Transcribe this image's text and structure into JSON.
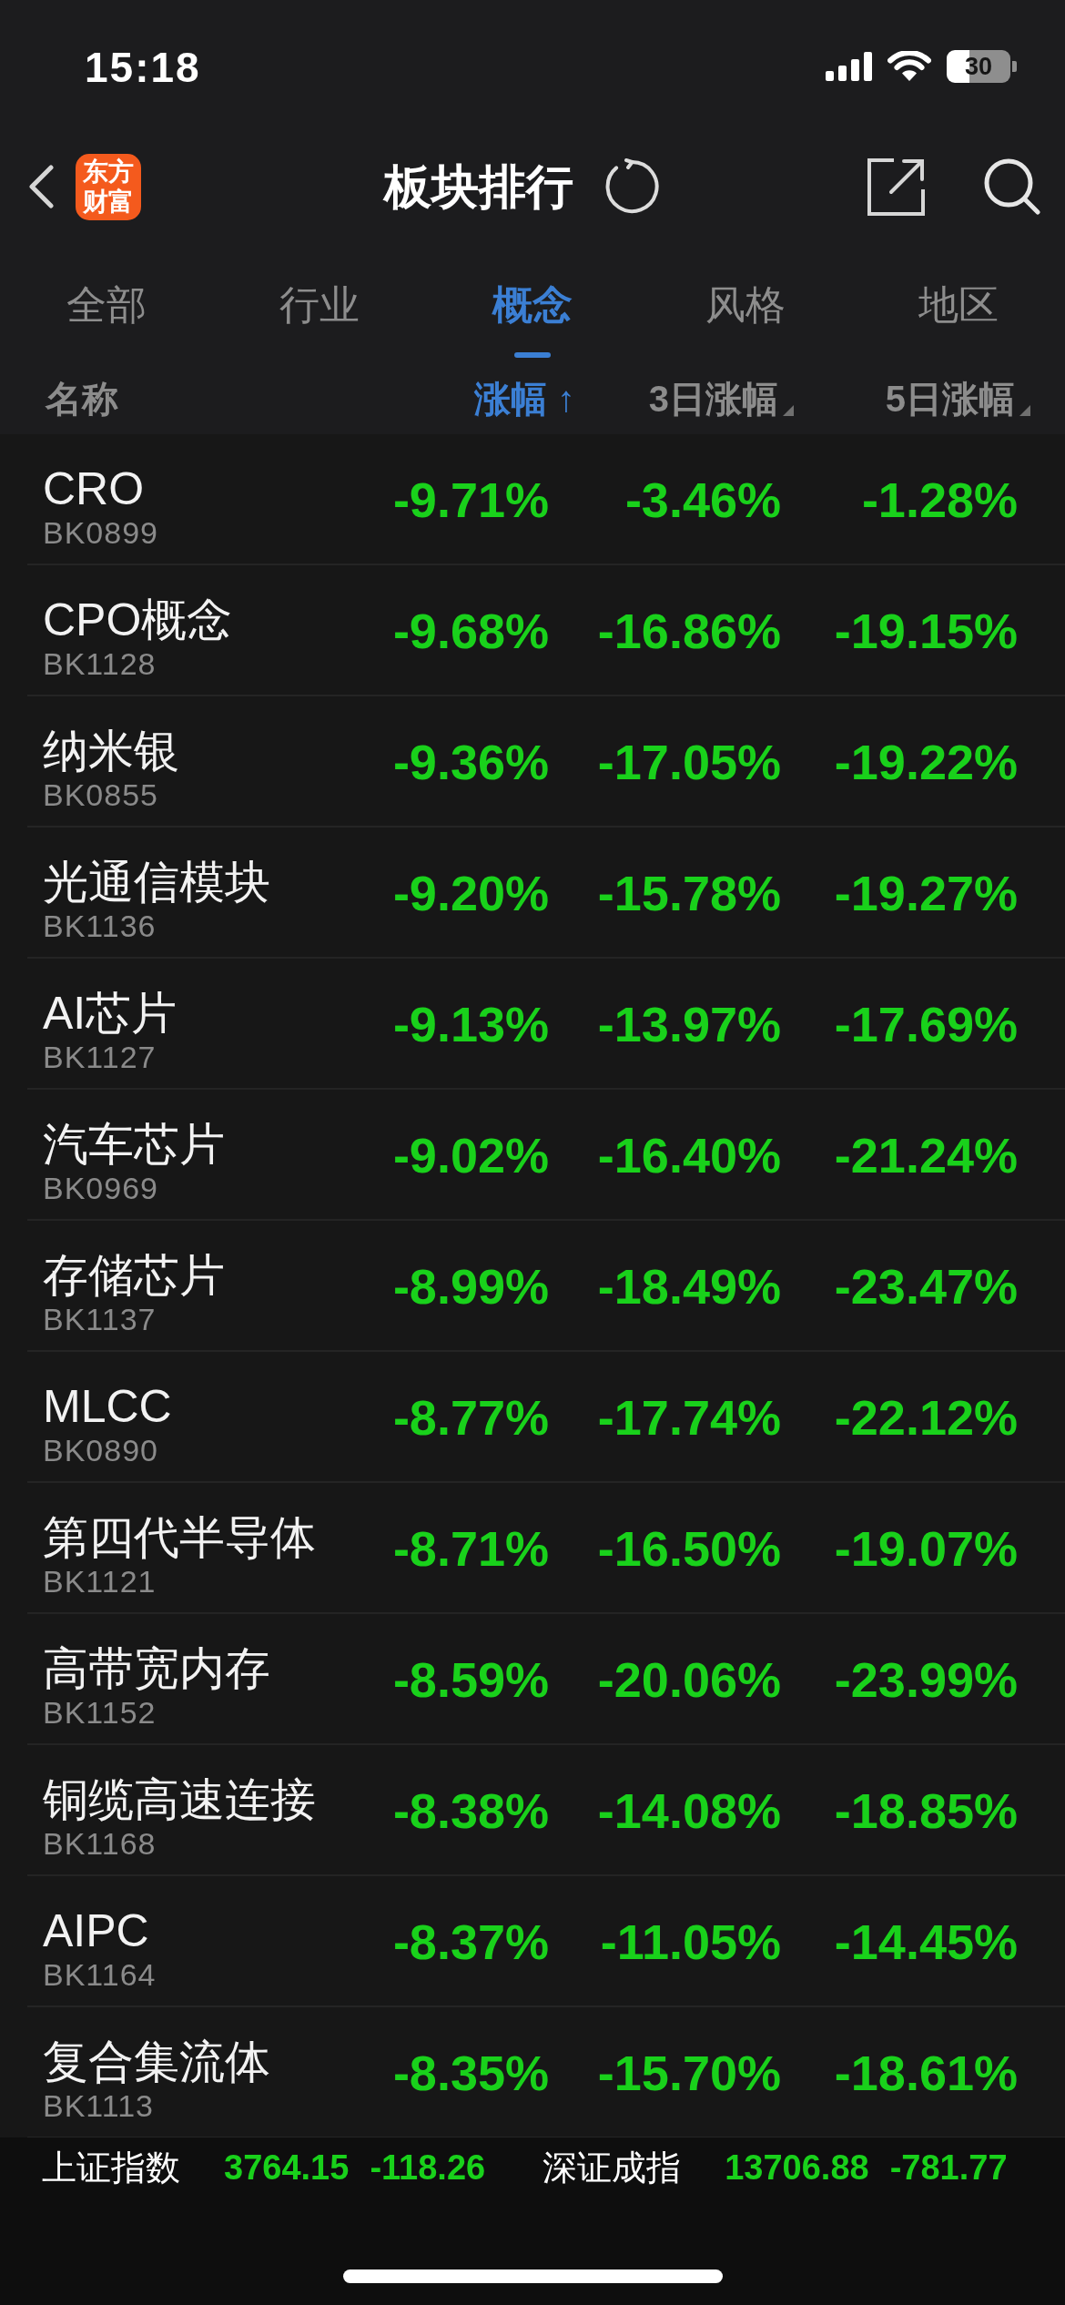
{
  "status_bar": {
    "time": "15:18",
    "battery": "30"
  },
  "header": {
    "logo": [
      "东方",
      "财富"
    ],
    "title": "板块排行"
  },
  "tabs": [
    {
      "label": "全部",
      "selected": false
    },
    {
      "label": "行业",
      "selected": false
    },
    {
      "label": "概念",
      "selected": true
    },
    {
      "label": "风格",
      "selected": false
    },
    {
      "label": "地区",
      "selected": false
    }
  ],
  "table": {
    "name_column": "名称",
    "columns": [
      {
        "label": "涨幅 ↑",
        "selected": true
      },
      {
        "label": "3日涨幅",
        "selected": false
      },
      {
        "label": "5日涨幅",
        "selected": false
      }
    ],
    "rows": [
      {
        "name": "CRO",
        "code": "BK0899",
        "values": [
          "-9.71%",
          "-3.46%",
          "-1.28%"
        ]
      },
      {
        "name": "CPO概念",
        "code": "BK1128",
        "values": [
          "-9.68%",
          "-16.86%",
          "-19.15%"
        ]
      },
      {
        "name": "纳米银",
        "code": "BK0855",
        "values": [
          "-9.36%",
          "-17.05%",
          "-19.22%"
        ]
      },
      {
        "name": "光通信模块",
        "code": "BK1136",
        "values": [
          "-9.20%",
          "-15.78%",
          "-19.27%"
        ]
      },
      {
        "name": "AI芯片",
        "code": "BK1127",
        "values": [
          "-9.13%",
          "-13.97%",
          "-17.69%"
        ]
      },
      {
        "name": "汽车芯片",
        "code": "BK0969",
        "values": [
          "-9.02%",
          "-16.40%",
          "-21.24%"
        ]
      },
      {
        "name": "存储芯片",
        "code": "BK1137",
        "values": [
          "-8.99%",
          "-18.49%",
          "-23.47%"
        ]
      },
      {
        "name": "MLCC",
        "code": "BK0890",
        "values": [
          "-8.77%",
          "-17.74%",
          "-22.12%"
        ]
      },
      {
        "name": "第四代半导体",
        "code": "BK1121",
        "values": [
          "-8.71%",
          "-16.50%",
          "-19.07%"
        ]
      },
      {
        "name": "高带宽内存",
        "code": "BK1152",
        "values": [
          "-8.59%",
          "-20.06%",
          "-23.99%"
        ]
      },
      {
        "name": "铜缆高速连接",
        "code": "BK1168",
        "values": [
          "-8.38%",
          "-14.08%",
          "-18.85%"
        ]
      },
      {
        "name": "AIPC",
        "code": "BK1164",
        "values": [
          "-8.37%",
          "-11.05%",
          "-14.45%"
        ]
      },
      {
        "name": "复合集流体",
        "code": "BK1113",
        "values": [
          "-8.35%",
          "-15.70%",
          "-18.61%"
        ]
      }
    ]
  },
  "index_bar": [
    {
      "name": "上证指数",
      "price": "3764.15",
      "change": "-118.26"
    },
    {
      "name": "深证成指",
      "price": "13706.88",
      "change": "-781.77"
    }
  ]
}
